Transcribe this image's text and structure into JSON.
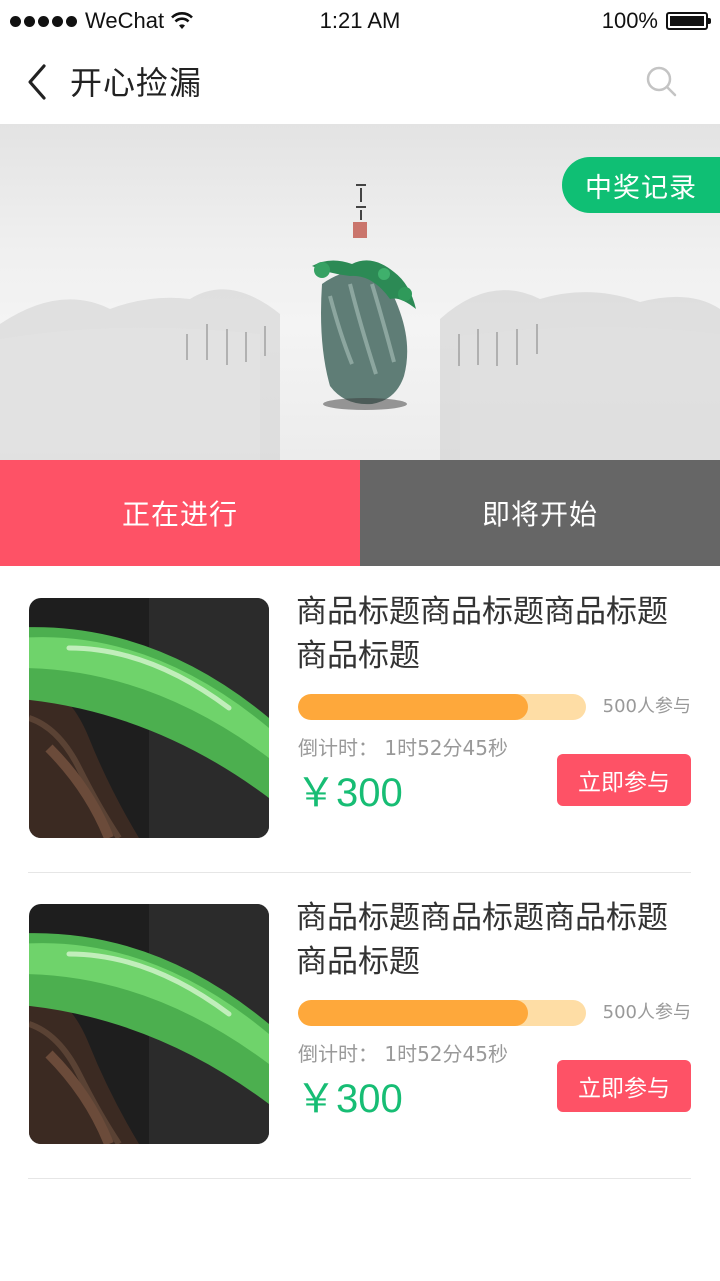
{
  "status_bar": {
    "carrier": "WeChat",
    "time": "1:21 AM",
    "battery": "100%"
  },
  "nav": {
    "title": "开心捡漏"
  },
  "banner": {
    "prize_record_label": "中奖记录"
  },
  "tabs": [
    {
      "label": "正在进行",
      "active": true
    },
    {
      "label": "即将开始",
      "active": false
    }
  ],
  "products": [
    {
      "title": "商品标题商品标题商品标题商品标题",
      "progress": 0.8,
      "participants": "500人参与",
      "countdown": "倒计时：  1时52分45秒",
      "price": "￥300",
      "join_label": "立即参与"
    },
    {
      "title": "商品标题商品标题商品标题商品标题",
      "progress": 0.8,
      "participants": "500人参与",
      "countdown": "倒计时：  1时52分45秒",
      "price": "￥300",
      "join_label": "立即参与"
    }
  ],
  "colors": {
    "accent_green": "#17bd74",
    "accent_red": "#fe5266",
    "progress_orange": "#fea83b",
    "progress_track": "#fedda5",
    "tab_inactive": "#666666"
  }
}
